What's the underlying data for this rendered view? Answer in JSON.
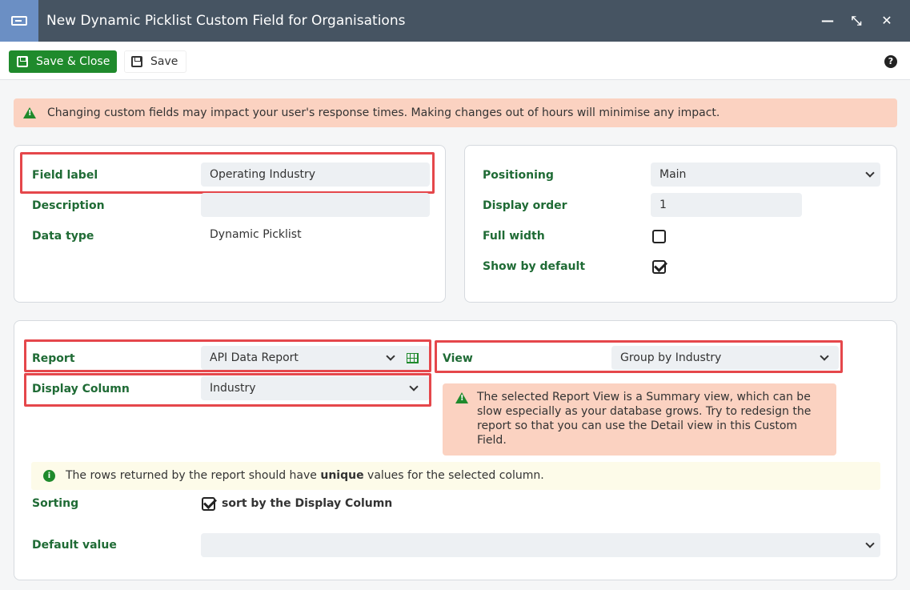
{
  "window": {
    "title": "New Dynamic Picklist Custom Field for Organisations",
    "icon": "form-icon",
    "controls": [
      "minimize-icon",
      "maximize-icon",
      "close-icon"
    ]
  },
  "toolbar": {
    "save_close_label": "Save & Close",
    "save_label": "Save",
    "help_glyph": "?"
  },
  "warning_banner": {
    "text": "Changing custom fields may impact your user's response times. Making changes out of hours will minimise any impact."
  },
  "general": {
    "field_label_label": "Field label",
    "field_label_value": "Operating Industry",
    "description_label": "Description",
    "description_value": "",
    "data_type_label": "Data type",
    "data_type_value": "Dynamic Picklist"
  },
  "position": {
    "positioning_label": "Positioning",
    "positioning_value": "Main",
    "display_order_label": "Display order",
    "display_order_value": "1",
    "full_width_label": "Full width",
    "full_width_checked": false,
    "show_by_default_label": "Show by default",
    "show_by_default_checked": true
  },
  "source": {
    "report_label": "Report",
    "report_value": "API Data Report",
    "view_label": "View",
    "view_value": "Group by Industry",
    "display_column_label": "Display Column",
    "display_column_value": "Industry",
    "view_warning": "The selected Report View is a Summary view, which can be slow especially as your database grows. Try to redesign the report so that you can use the Detail view in this Custom Field.",
    "info_prefix": "The rows returned by the report should have",
    "info_emphasis": "unique",
    "info_suffix": "values for the selected column.",
    "sorting_label": "Sorting",
    "sorting_option": "sort by the Display Column",
    "sorting_checked": true,
    "default_value_label": "Default value",
    "default_value": ""
  },
  "colors": {
    "titlebar": "#465462",
    "accent_green": "#1f8a2c",
    "label_green": "#1f6b35",
    "warning_bg": "#fbd2c1",
    "highlight_red": "#e5474b"
  }
}
